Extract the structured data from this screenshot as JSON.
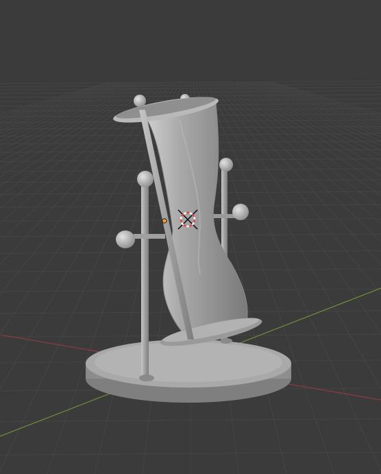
{
  "viewport": {
    "mode": "solid",
    "background": "#3b3b3b",
    "grid_color": "#474747",
    "x_axis_color": "#8a3a44",
    "y_axis_color": "#6a8a34"
  },
  "scene": {
    "object": "hourglass",
    "object_color": "#9c9c9c",
    "origin_color": "#f2a030",
    "cursor_icon": "3d-cursor-icon",
    "cursor_colors": [
      "#e04848",
      "#ffffff"
    ]
  }
}
